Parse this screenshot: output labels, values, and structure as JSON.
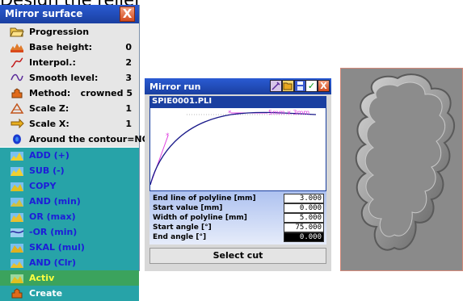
{
  "page": {
    "heading": "Design the relief"
  },
  "mirror_surface": {
    "title": "Mirror surface",
    "close_label": "X",
    "items": [
      {
        "label": "Progression",
        "value": "",
        "icon": "folder-open-icon"
      },
      {
        "label": "Base height:",
        "value": "0",
        "icon": "base-height-icon"
      },
      {
        "label": "Interpol.:",
        "value": "2",
        "icon": "interpolation-icon"
      },
      {
        "label": "Smooth level:",
        "value": "3",
        "icon": "smooth-icon"
      },
      {
        "label": "Method:",
        "value": "crowned 5",
        "icon": "method-icon"
      },
      {
        "label": "Scale Z:",
        "value": "1",
        "icon": "scale-z-icon"
      },
      {
        "label": "Scale X:",
        "value": "1",
        "icon": "scale-x-icon"
      },
      {
        "label": "Around the contour=NO",
        "value": "",
        "icon": "contour-icon"
      },
      {
        "label": "ADD (+)",
        "value": "",
        "icon": "add-icon"
      },
      {
        "label": "SUB (-)",
        "value": "",
        "icon": "sub-icon"
      },
      {
        "label": "COPY",
        "value": "",
        "icon": "copy-icon"
      },
      {
        "label": "AND (min)",
        "value": "",
        "icon": "and-min-icon"
      },
      {
        "label": "OR (max)",
        "value": "",
        "icon": "or-max-icon"
      },
      {
        "label": "-OR (min)",
        "value": "",
        "icon": "neg-or-min-icon"
      },
      {
        "label": "SKAL (mul)",
        "value": "",
        "icon": "skal-mul-icon"
      },
      {
        "label": "AND (Clr)",
        "value": "",
        "icon": "and-clr-icon"
      },
      {
        "label": "Activ",
        "value": "",
        "icon": "activ-icon"
      },
      {
        "label": "Create",
        "value": "",
        "icon": "create-icon"
      }
    ]
  },
  "mirror_run": {
    "title": "Mirror run",
    "toolbar": {
      "check_label": "✓",
      "close_label": "X"
    },
    "filename": "SPIE0001.PLI",
    "plot_annotation": "5mm x 3mm",
    "params": [
      {
        "label": "End line of polyline [mm]",
        "value": "3.000"
      },
      {
        "label": "Start value [mm]",
        "value": "0.000"
      },
      {
        "label": "Width of polyline [mm]",
        "value": "5.000"
      },
      {
        "label": "Start angle [°]",
        "value": "75.000"
      },
      {
        "label": "End angle [°]",
        "value": "0.000"
      }
    ],
    "select_cut_label": "Select cut"
  },
  "colors": {
    "title_bar": "#1a3fa0",
    "teal_row": "#27a3a8",
    "activ_row": "#3ba35d",
    "curve": "#1a1a8a",
    "guide": "#e040e0"
  }
}
